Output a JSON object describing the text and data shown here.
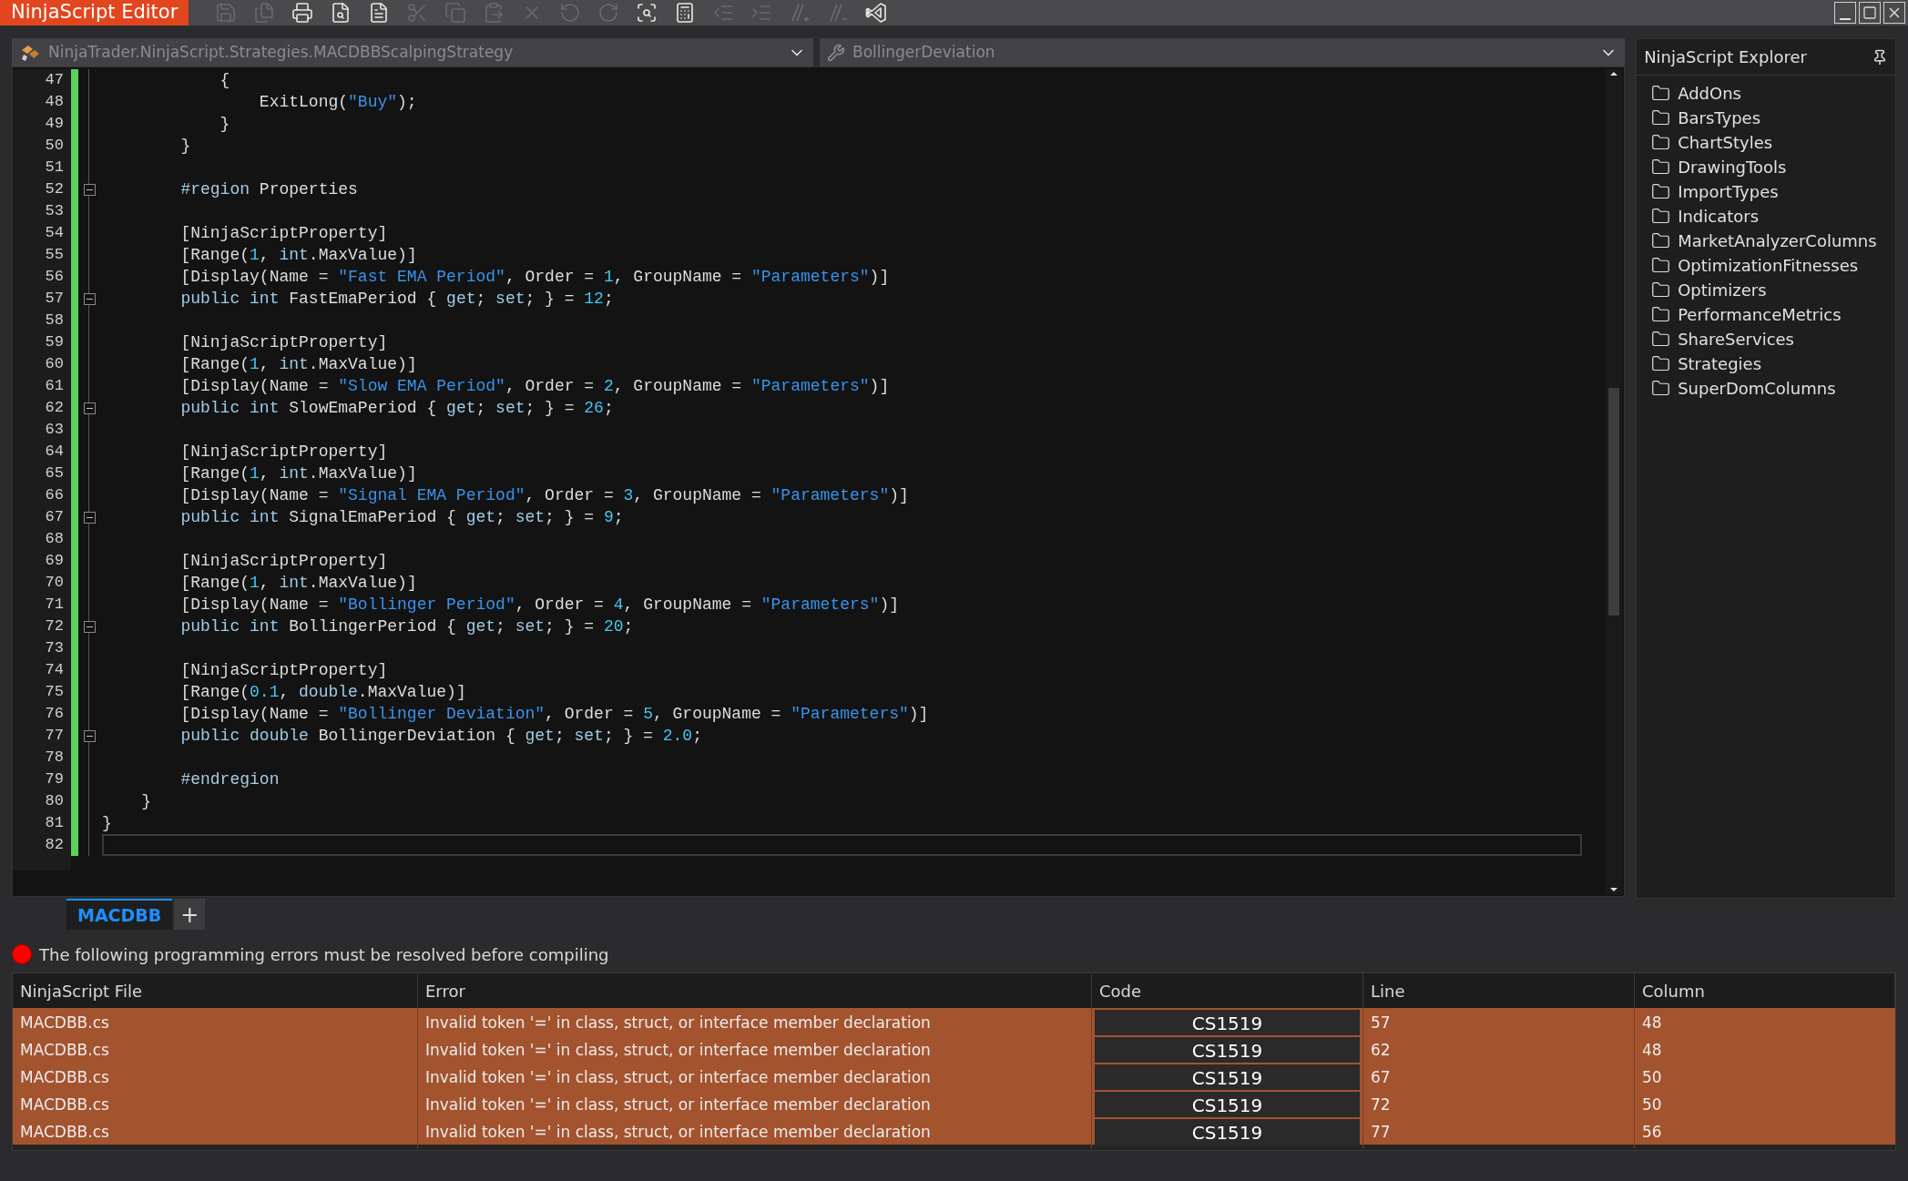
{
  "window": {
    "title": "NinjaScript Editor"
  },
  "toolbar": [
    {
      "kind": "save",
      "disabled": true
    },
    {
      "kind": "save-all",
      "disabled": true
    },
    {
      "kind": "print",
      "disabled": false
    },
    {
      "kind": "print-preview",
      "disabled": false
    },
    {
      "kind": "list",
      "disabled": false
    },
    {
      "kind": "cut",
      "disabled": true
    },
    {
      "kind": "copy",
      "disabled": true
    },
    {
      "kind": "paste",
      "disabled": true
    },
    {
      "kind": "delete",
      "disabled": true
    },
    {
      "kind": "undo",
      "disabled": true
    },
    {
      "kind": "redo",
      "disabled": true
    },
    {
      "kind": "find",
      "disabled": false
    },
    {
      "kind": "compile",
      "disabled": false
    },
    {
      "kind": "outdent",
      "disabled": true
    },
    {
      "kind": "indent",
      "disabled": true
    },
    {
      "kind": "comment",
      "disabled": true
    },
    {
      "kind": "uncomment",
      "disabled": true
    },
    {
      "kind": "visual-studio",
      "disabled": false
    }
  ],
  "type_selector": {
    "value": "NinjaTrader.NinjaScript.Strategies.MACDBBScalpingStrategy"
  },
  "member_selector": {
    "value": "BollingerDeviation"
  },
  "code": [
    {
      "number": "47",
      "fold": false,
      "current": false,
      "tokens": [
        {
          "kind": "plain",
          "text": "            {"
        }
      ]
    },
    {
      "number": "48",
      "fold": false,
      "current": false,
      "tokens": [
        {
          "kind": "plain",
          "text": "                ExitLong("
        },
        {
          "kind": "string",
          "text": "\"Buy\""
        },
        {
          "kind": "plain",
          "text": ");"
        }
      ]
    },
    {
      "number": "49",
      "fold": false,
      "current": false,
      "tokens": [
        {
          "kind": "plain",
          "text": "            }"
        }
      ]
    },
    {
      "number": "50",
      "fold": false,
      "current": false,
      "tokens": [
        {
          "kind": "plain",
          "text": "        }"
        }
      ]
    },
    {
      "number": "51",
      "fold": false,
      "current": false
    },
    {
      "number": "52",
      "fold": true,
      "current": false,
      "tokens": [
        {
          "kind": "directive",
          "text": "        #region"
        },
        {
          "kind": "plain",
          "text": " Properties"
        }
      ]
    },
    {
      "number": "53",
      "fold": false,
      "current": false
    },
    {
      "number": "54",
      "fold": false,
      "current": false,
      "tokens": [
        {
          "kind": "plain",
          "text": "        [NinjaScriptProperty]"
        }
      ]
    },
    {
      "number": "55",
      "fold": false,
      "current": false,
      "tokens": [
        {
          "kind": "plain",
          "text": "        [Range("
        },
        {
          "kind": "number",
          "text": "1"
        },
        {
          "kind": "plain",
          "text": ", "
        },
        {
          "kind": "keyword",
          "text": "int"
        },
        {
          "kind": "plain",
          "text": ".MaxValue)]"
        }
      ]
    },
    {
      "number": "56",
      "fold": false,
      "current": false,
      "tokens": [
        {
          "kind": "plain",
          "text": "        [Display(Name = "
        },
        {
          "kind": "string",
          "text": "\"Fast EMA Period\""
        },
        {
          "kind": "plain",
          "text": ", Order = "
        },
        {
          "kind": "number",
          "text": "1"
        },
        {
          "kind": "plain",
          "text": ", GroupName = "
        },
        {
          "kind": "string",
          "text": "\"Parameters\""
        },
        {
          "kind": "plain",
          "text": ")]"
        }
      ]
    },
    {
      "number": "57",
      "fold": true,
      "current": false,
      "tokens": [
        {
          "kind": "keyword",
          "text": "        public int"
        },
        {
          "kind": "plain",
          "text": " FastEmaPeriod { "
        },
        {
          "kind": "keyword",
          "text": "get"
        },
        {
          "kind": "plain",
          "text": "; "
        },
        {
          "kind": "keyword",
          "text": "set"
        },
        {
          "kind": "plain",
          "text": "; } = "
        },
        {
          "kind": "number",
          "text": "12"
        },
        {
          "kind": "plain",
          "text": ";"
        }
      ]
    },
    {
      "number": "58",
      "fold": false,
      "current": false
    },
    {
      "number": "59",
      "fold": false,
      "current": false,
      "tokens": [
        {
          "kind": "plain",
          "text": "        [NinjaScriptProperty]"
        }
      ]
    },
    {
      "number": "60",
      "fold": false,
      "current": false,
      "tokens": [
        {
          "kind": "plain",
          "text": "        [Range("
        },
        {
          "kind": "number",
          "text": "1"
        },
        {
          "kind": "plain",
          "text": ", "
        },
        {
          "kind": "keyword",
          "text": "int"
        },
        {
          "kind": "plain",
          "text": ".MaxValue)]"
        }
      ]
    },
    {
      "number": "61",
      "fold": false,
      "current": false,
      "tokens": [
        {
          "kind": "plain",
          "text": "        [Display(Name = "
        },
        {
          "kind": "string",
          "text": "\"Slow EMA Period\""
        },
        {
          "kind": "plain",
          "text": ", Order = "
        },
        {
          "kind": "number",
          "text": "2"
        },
        {
          "kind": "plain",
          "text": ", GroupName = "
        },
        {
          "kind": "string",
          "text": "\"Parameters\""
        },
        {
          "kind": "plain",
          "text": ")]"
        }
      ]
    },
    {
      "number": "62",
      "fold": true,
      "current": false,
      "tokens": [
        {
          "kind": "keyword",
          "text": "        public int"
        },
        {
          "kind": "plain",
          "text": " SlowEmaPeriod { "
        },
        {
          "kind": "keyword",
          "text": "get"
        },
        {
          "kind": "plain",
          "text": "; "
        },
        {
          "kind": "keyword",
          "text": "set"
        },
        {
          "kind": "plain",
          "text": "; } = "
        },
        {
          "kind": "number",
          "text": "26"
        },
        {
          "kind": "plain",
          "text": ";"
        }
      ]
    },
    {
      "number": "63",
      "fold": false,
      "current": false
    },
    {
      "number": "64",
      "fold": false,
      "current": false,
      "tokens": [
        {
          "kind": "plain",
          "text": "        [NinjaScriptProperty]"
        }
      ]
    },
    {
      "number": "65",
      "fold": false,
      "current": false,
      "tokens": [
        {
          "kind": "plain",
          "text": "        [Range("
        },
        {
          "kind": "number",
          "text": "1"
        },
        {
          "kind": "plain",
          "text": ", "
        },
        {
          "kind": "keyword",
          "text": "int"
        },
        {
          "kind": "plain",
          "text": ".MaxValue)]"
        }
      ]
    },
    {
      "number": "66",
      "fold": false,
      "current": false,
      "tokens": [
        {
          "kind": "plain",
          "text": "        [Display(Name = "
        },
        {
          "kind": "string",
          "text": "\"Signal EMA Period\""
        },
        {
          "kind": "plain",
          "text": ", Order = "
        },
        {
          "kind": "number",
          "text": "3"
        },
        {
          "kind": "plain",
          "text": ", GroupName = "
        },
        {
          "kind": "string",
          "text": "\"Parameters\""
        },
        {
          "kind": "plain",
          "text": ")]"
        }
      ]
    },
    {
      "number": "67",
      "fold": true,
      "current": false,
      "tokens": [
        {
          "kind": "keyword",
          "text": "        public int"
        },
        {
          "kind": "plain",
          "text": " SignalEmaPeriod { "
        },
        {
          "kind": "keyword",
          "text": "get"
        },
        {
          "kind": "plain",
          "text": "; "
        },
        {
          "kind": "keyword",
          "text": "set"
        },
        {
          "kind": "plain",
          "text": "; } = "
        },
        {
          "kind": "number",
          "text": "9"
        },
        {
          "kind": "plain",
          "text": ";"
        }
      ]
    },
    {
      "number": "68",
      "fold": false,
      "current": false
    },
    {
      "number": "69",
      "fold": false,
      "current": false,
      "tokens": [
        {
          "kind": "plain",
          "text": "        [NinjaScriptProperty]"
        }
      ]
    },
    {
      "number": "70",
      "fold": false,
      "current": false,
      "tokens": [
        {
          "kind": "plain",
          "text": "        [Range("
        },
        {
          "kind": "number",
          "text": "1"
        },
        {
          "kind": "plain",
          "text": ", "
        },
        {
          "kind": "keyword",
          "text": "int"
        },
        {
          "kind": "plain",
          "text": ".MaxValue)]"
        }
      ]
    },
    {
      "number": "71",
      "fold": false,
      "current": false,
      "tokens": [
        {
          "kind": "plain",
          "text": "        [Display(Name = "
        },
        {
          "kind": "string",
          "text": "\"Bollinger Period\""
        },
        {
          "kind": "plain",
          "text": ", Order = "
        },
        {
          "kind": "number",
          "text": "4"
        },
        {
          "kind": "plain",
          "text": ", GroupName = "
        },
        {
          "kind": "string",
          "text": "\"Parameters\""
        },
        {
          "kind": "plain",
          "text": ")]"
        }
      ]
    },
    {
      "number": "72",
      "fold": true,
      "current": false,
      "tokens": [
        {
          "kind": "keyword",
          "text": "        public int"
        },
        {
          "kind": "plain",
          "text": " BollingerPeriod { "
        },
        {
          "kind": "keyword",
          "text": "get"
        },
        {
          "kind": "plain",
          "text": "; "
        },
        {
          "kind": "keyword",
          "text": "set"
        },
        {
          "kind": "plain",
          "text": "; } = "
        },
        {
          "kind": "number",
          "text": "20"
        },
        {
          "kind": "plain",
          "text": ";"
        }
      ]
    },
    {
      "number": "73",
      "fold": false,
      "current": false
    },
    {
      "number": "74",
      "fold": false,
      "current": false,
      "tokens": [
        {
          "kind": "plain",
          "text": "        [NinjaScriptProperty]"
        }
      ]
    },
    {
      "number": "75",
      "fold": false,
      "current": false,
      "tokens": [
        {
          "kind": "plain",
          "text": "        [Range("
        },
        {
          "kind": "number",
          "text": "0.1"
        },
        {
          "kind": "plain",
          "text": ", "
        },
        {
          "kind": "keyword",
          "text": "double"
        },
        {
          "kind": "plain",
          "text": ".MaxValue)]"
        }
      ]
    },
    {
      "number": "76",
      "fold": false,
      "current": false,
      "tokens": [
        {
          "kind": "plain",
          "text": "        [Display(Name = "
        },
        {
          "kind": "string",
          "text": "\"Bollinger Deviation\""
        },
        {
          "kind": "plain",
          "text": ", Order = "
        },
        {
          "kind": "number",
          "text": "5"
        },
        {
          "kind": "plain",
          "text": ", GroupName = "
        },
        {
          "kind": "string",
          "text": "\"Parameters\""
        },
        {
          "kind": "plain",
          "text": ")]"
        }
      ]
    },
    {
      "number": "77",
      "fold": true,
      "current": false,
      "tokens": [
        {
          "kind": "keyword",
          "text": "        public double"
        },
        {
          "kind": "plain",
          "text": " BollingerDeviation { "
        },
        {
          "kind": "keyword",
          "text": "get"
        },
        {
          "kind": "plain",
          "text": "; "
        },
        {
          "kind": "keyword",
          "text": "set"
        },
        {
          "kind": "plain",
          "text": "; } = "
        },
        {
          "kind": "number",
          "text": "2.0"
        },
        {
          "kind": "plain",
          "text": ";"
        }
      ]
    },
    {
      "number": "78",
      "fold": false,
      "current": false
    },
    {
      "number": "79",
      "fold": false,
      "current": false,
      "tokens": [
        {
          "kind": "directive",
          "text": "        #endregion"
        }
      ]
    },
    {
      "number": "80",
      "fold": false,
      "current": false,
      "tokens": [
        {
          "kind": "plain",
          "text": "    }"
        }
      ]
    },
    {
      "number": "81",
      "fold": false,
      "current": false,
      "tokens": [
        {
          "kind": "plain",
          "text": "}"
        }
      ]
    },
    {
      "number": "82",
      "fold": false,
      "current": true
    }
  ],
  "explorer": {
    "title": "NinjaScript Explorer",
    "items": [
      "AddOns",
      "BarsTypes",
      "ChartStyles",
      "DrawingTools",
      "ImportTypes",
      "Indicators",
      "MarketAnalyzerColumns",
      "OptimizationFitnesses",
      "Optimizers",
      "PerformanceMetrics",
      "ShareServices",
      "Strategies",
      "SuperDomColumns"
    ]
  },
  "file_tabs": [
    {
      "label": "MACDBB",
      "selected": true
    }
  ],
  "add_tab": "+",
  "error_message": "The following programming errors must be resolved before compiling",
  "errors": {
    "columns": [
      "NinjaScript File",
      "Error",
      "Code",
      "Line",
      "Column"
    ],
    "rows": [
      {
        "file": "MACDBB.cs",
        "error": "Invalid token '=' in class, struct, or interface member declaration",
        "code": "CS1519",
        "line": "57",
        "column": "48"
      },
      {
        "file": "MACDBB.cs",
        "error": "Invalid token '=' in class, struct, or interface member declaration",
        "code": "CS1519",
        "line": "62",
        "column": "48"
      },
      {
        "file": "MACDBB.cs",
        "error": "Invalid token '=' in class, struct, or interface member declaration",
        "code": "CS1519",
        "line": "67",
        "column": "50"
      },
      {
        "file": "MACDBB.cs",
        "error": "Invalid token '=' in class, struct, or interface member declaration",
        "code": "CS1519",
        "line": "72",
        "column": "50"
      },
      {
        "file": "MACDBB.cs",
        "error": "Invalid token '=' in class, struct, or interface member declaration",
        "code": "CS1519",
        "line": "77",
        "column": "56"
      }
    ]
  }
}
